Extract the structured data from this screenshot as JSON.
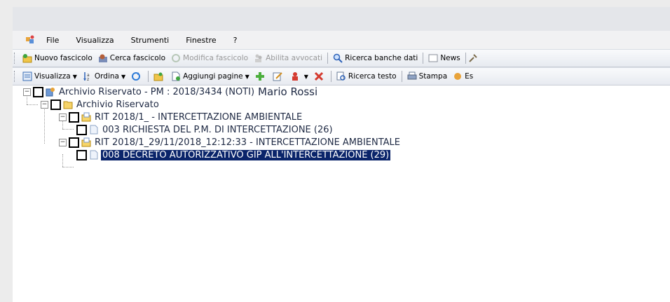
{
  "menubar": {
    "items": [
      "File",
      "Visualizza",
      "Strumenti",
      "Finestre",
      "?"
    ]
  },
  "toolbar1": {
    "nuovo_fascicolo": "Nuovo fascicolo",
    "cerca_fascicolo": "Cerca fascicolo",
    "modifica_fascicolo": "Modifica fascicolo",
    "abilita_avvocati": "Abilita avvocati",
    "ricerca_banche_dati": "Ricerca banche dati",
    "news": "News"
  },
  "toolbar2": {
    "visualizza": "Visualizza",
    "ordina": "Ordina",
    "aggiungi_pagine": "Aggiungi pagine",
    "ricerca_testo": "Ricerca testo",
    "stampa": "Stampa",
    "es": "Es"
  },
  "tree": {
    "root": {
      "label": "Archivio Riservato - PM : 2018/3434 (NOTI)",
      "user": "Mario Rossi"
    },
    "archive": "Archivio Riservato",
    "rit1": "RIT 2018/1_ - INTERCETTAZIONE AMBIENTALE",
    "doc1": "003 RICHIESTA DEL P.M. DI INTERCETTAZIONE (26)",
    "rit2": "RIT 2018/1_29/11/2018_12:12:33 - INTERCETTAZIONE AMBIENTALE",
    "doc2": "008 DECRETO AUTORIZZATIVO GIP ALL'INTERCETTAZIONE (29)"
  },
  "colors": {
    "selection": "#0a246a",
    "window_bg": "#ffffff"
  }
}
